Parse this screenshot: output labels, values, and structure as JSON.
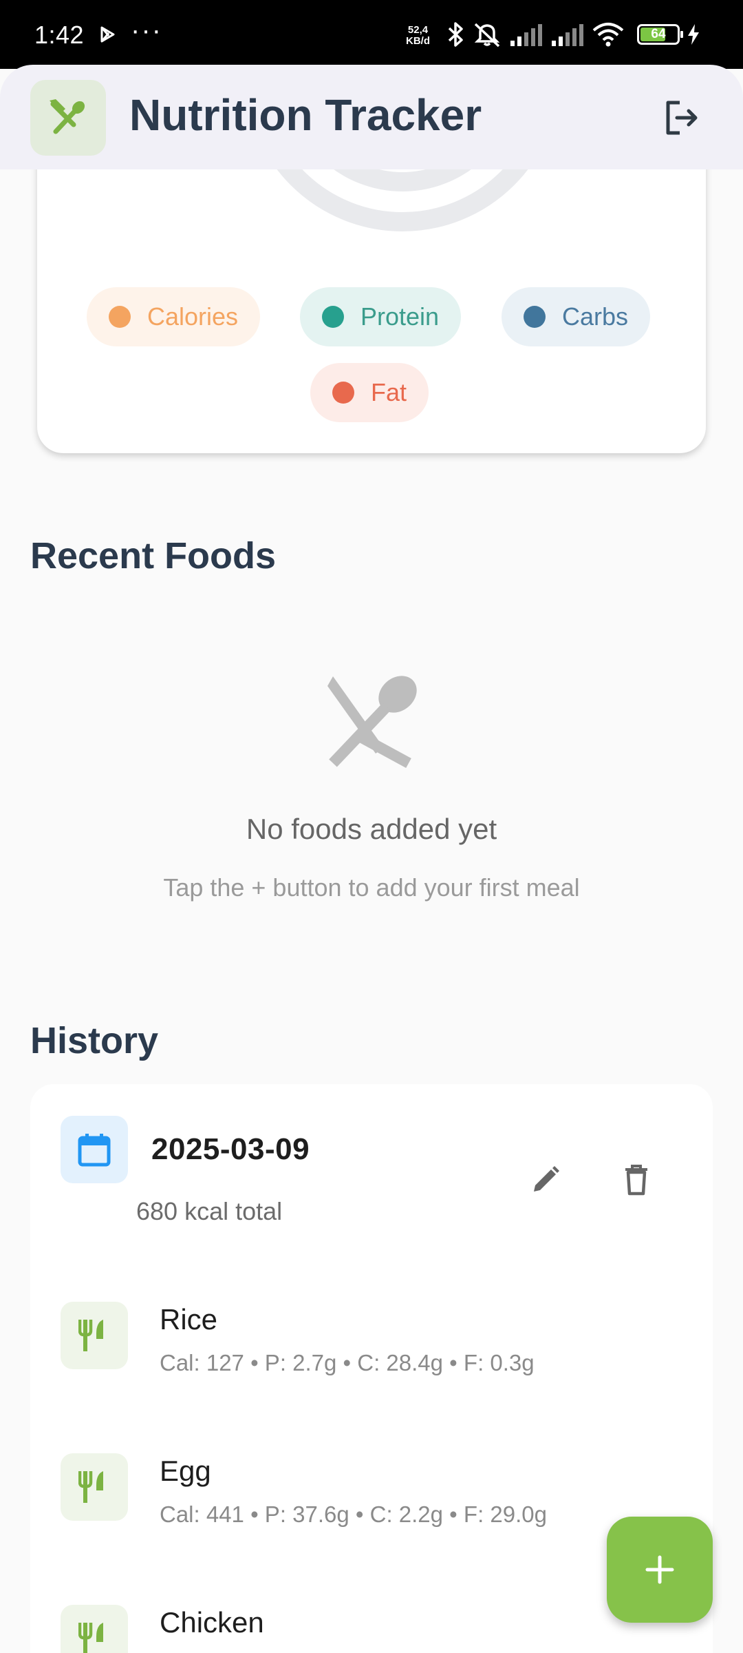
{
  "status_bar": {
    "time": "1:42",
    "dots": "···",
    "network_speed_value": "52,4",
    "network_speed_unit": "KB/d",
    "battery": "64"
  },
  "app_bar": {
    "title": "Nutrition Tracker",
    "logo_icon": "fork-spoon-icon",
    "logout_icon": "logout-icon"
  },
  "chart_legend": [
    {
      "label": "Calories",
      "color": "#f4a460",
      "chip_bg": "#fef3ea",
      "text_color": "#f4a460"
    },
    {
      "label": "Protein",
      "color": "#27a08e",
      "chip_bg": "#e4f3f1",
      "text_color": "#3a9c8c"
    },
    {
      "label": "Carbs",
      "color": "#41769c",
      "chip_bg": "#eaf1f6",
      "text_color": "#4a7aa0"
    },
    {
      "label": "Fat",
      "color": "#e8694d",
      "chip_bg": "#fdece8",
      "text_color": "#e8694d"
    }
  ],
  "recent_foods": {
    "title": "Recent Foods",
    "empty_title": "No foods added yet",
    "empty_subtitle": "Tap the + button to add your first meal"
  },
  "history": {
    "title": "History",
    "entries": [
      {
        "date": "2025-03-09",
        "total": "680 kcal total",
        "foods": [
          {
            "name": "Rice",
            "stats": "Cal: 127 • P: 2.7g • C: 28.4g • F: 0.3g"
          },
          {
            "name": "Egg",
            "stats": "Cal: 441 • P: 37.6g • C: 2.2g • F: 29.0g"
          },
          {
            "name": "Chicken",
            "stats": ""
          }
        ]
      }
    ]
  },
  "colors": {
    "accent_green": "#86c24a",
    "title_text": "#2b3a4d",
    "date_icon_blue": "#2196f3"
  },
  "fab": {
    "label": "+",
    "icon": "plus-icon"
  }
}
